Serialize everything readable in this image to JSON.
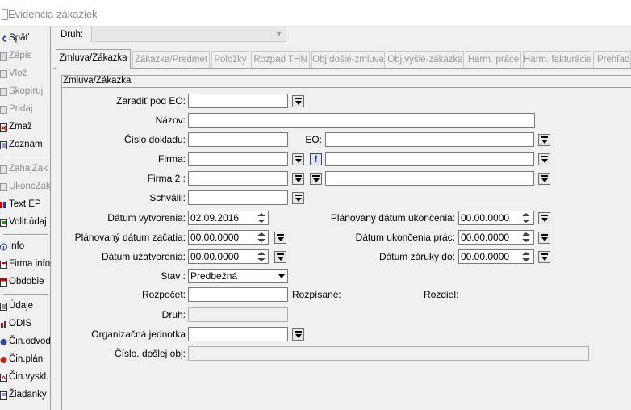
{
  "window": {
    "title": "Evidencia zákaziek"
  },
  "sidebar": {
    "items": [
      {
        "label": "Späť",
        "icon": "back-arrow-icon",
        "enabled": true
      },
      {
        "label": "Zápis",
        "icon": "save-icon",
        "enabled": false
      },
      {
        "label": "Vlož",
        "icon": "insert-icon",
        "enabled": false
      },
      {
        "label": "Skopíruj",
        "icon": "copy-icon",
        "enabled": false
      },
      {
        "label": "Pridaj",
        "icon": "add-icon",
        "enabled": false
      },
      {
        "label": "Zmaž",
        "icon": "delete-icon",
        "enabled": true
      },
      {
        "label": "Zoznam",
        "icon": "list-icon",
        "enabled": true
      },
      {
        "label": "ZahajZak",
        "icon": "start-order-icon",
        "enabled": false
      },
      {
        "label": "UkoncZak",
        "icon": "end-order-icon",
        "enabled": false
      },
      {
        "label": "Text EP",
        "icon": "text-icon",
        "enabled": true
      },
      {
        "label": "Volit.údaj",
        "icon": "optional-data-icon",
        "enabled": true
      },
      {
        "label": "Info",
        "icon": "info-icon",
        "enabled": true
      },
      {
        "label": "Firma info",
        "icon": "company-info-icon",
        "enabled": true
      },
      {
        "label": "Obdobie",
        "icon": "calendar-icon",
        "enabled": true
      },
      {
        "label": "Údaje",
        "icon": "data-icon",
        "enabled": true
      },
      {
        "label": "ODIS",
        "icon": "odis-icon",
        "enabled": true
      },
      {
        "label": "Čin.odvod",
        "icon": "activity-icon",
        "enabled": true
      },
      {
        "label": "Čin.plán",
        "icon": "plan-icon",
        "enabled": true
      },
      {
        "label": "Čin.vyskl.",
        "icon": "dispatch-icon",
        "enabled": true
      },
      {
        "label": "Žiadanky",
        "icon": "request-icon",
        "enabled": true
      }
    ]
  },
  "header": {
    "druh_label": "Druh:",
    "druh_value": ""
  },
  "tabs": [
    {
      "label": "Zmluva/Zákazka",
      "active": true
    },
    {
      "label": "Zákazka/Predmet",
      "active": false
    },
    {
      "label": "Položky",
      "active": false
    },
    {
      "label": "Rozpad THN",
      "active": false
    },
    {
      "label": "Obj.došlé-zmluva",
      "active": false
    },
    {
      "label": "Obj.vyšlé-zákazka",
      "active": false
    },
    {
      "label": "Harm. práce",
      "active": false
    },
    {
      "label": "Harm. fakturácie",
      "active": false
    },
    {
      "label": "Prehľad",
      "active": false
    }
  ],
  "group_title": "Zmluva/Zákazka",
  "form": {
    "zaradit_pod_eo": {
      "label": "Zaradiť pod EO:",
      "value": ""
    },
    "nazov": {
      "label": "Názov:",
      "value": ""
    },
    "cislo_dokladu": {
      "label": "Číslo dokladu:",
      "value": ""
    },
    "eo": {
      "label": "EO:",
      "value": ""
    },
    "firma": {
      "label": "Firma:",
      "value": "",
      "name": ""
    },
    "firma2": {
      "label": "Firma 2 :",
      "value": "",
      "name": ""
    },
    "schvalil": {
      "label": "Schválil:",
      "value": ""
    },
    "datum_vytvorenia": {
      "label": "Dátum vytvorenia:",
      "value": "02.09.2016"
    },
    "planovany_datum_ukoncenia": {
      "label": "Plánovaný dátum ukončenia:",
      "value": "00.00.0000"
    },
    "planovany_datum_zacatia": {
      "label": "Plánovaný dátum začatia:",
      "value": "00.00.0000"
    },
    "datum_ukoncenia_prac": {
      "label": "Dátum ukončenia prác:",
      "value": "00.00.0000"
    },
    "datum_uzatvorenia": {
      "label": "Dátum uzatvorenia:",
      "value": "00.00.0000"
    },
    "datum_zaruky_do": {
      "label": "Dátum záruky do:",
      "value": "00.00.0000"
    },
    "stav": {
      "label": "Stav :",
      "value": "Predbežná"
    },
    "rozpocet": {
      "label": "Rozpočet:",
      "value": ""
    },
    "rozpisane": {
      "label": "Rozpísané:"
    },
    "rozdiel": {
      "label": "Rozdiel:"
    },
    "druh": {
      "label": "Druh:",
      "value": ""
    },
    "organizacna_jednotka": {
      "label": "Organizačná jednotka",
      "value": ""
    },
    "cislo_doslej_obj": {
      "label": "Číslo. došlej obj:",
      "value": ""
    }
  }
}
